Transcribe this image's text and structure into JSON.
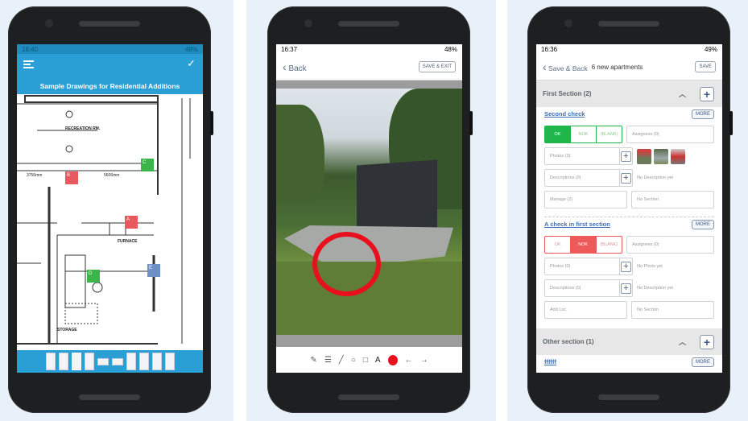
{
  "phone1": {
    "status": {
      "time": "16:40",
      "battery": "48%"
    },
    "header": {
      "title": "Sample Drawings for Residential Additions",
      "menu_icon": "hamburger-icon",
      "confirm_icon": "check-icon"
    },
    "plan_labels": [
      "RECREATION RM.",
      "FURNACE",
      "STORAGE",
      "3756mm",
      "5606mm"
    ],
    "markers": [
      {
        "label": "C",
        "color": "#3ab54a"
      },
      {
        "label": "B",
        "color": "#e8595d"
      },
      {
        "label": "A",
        "color": "#e8595d"
      },
      {
        "label": "D",
        "color": "#3ab54a"
      },
      {
        "label": "E",
        "color": "#6f8fc9"
      }
    ],
    "thumbnail_count": 10,
    "accent": "#2a9fd6"
  },
  "phone2": {
    "status": {
      "time": "16:37",
      "battery": "48%"
    },
    "header": {
      "back_label": "Back",
      "save_exit_label": "SAVE & EXIT"
    },
    "tools": [
      "brush-icon",
      "stroke-width-icon",
      "line-icon",
      "circle-icon",
      "square-icon",
      "text-icon",
      "color-icon",
      "undo-icon",
      "redo-icon"
    ],
    "text_tool": "A",
    "active_color": "#e8101c"
  },
  "phone3": {
    "status": {
      "time": "16:36",
      "battery": "49%"
    },
    "header": {
      "back_label": "Save & Back",
      "title": "6 new apartments",
      "save_label": "SAVE"
    },
    "sections": [
      {
        "title": "First Section (2)",
        "checks": [
          {
            "name": "Second check",
            "more": "MORE",
            "options": [
              "OK",
              "NOK",
              "(BLANK)"
            ],
            "selected": "OK",
            "assignees": "Assignees (0)",
            "photos": "Photos (3)",
            "photo_note": "",
            "descriptions": "Descriptions (0)",
            "desc_note": "No Description yet",
            "location": "Manage (2)",
            "section": "No Section"
          },
          {
            "name": "A check in first section",
            "more": "MORE",
            "options": [
              "OK",
              "NOK",
              "(BLANK)"
            ],
            "selected": "NOK",
            "assignees": "Assignees (0)",
            "photos": "Photos (0)",
            "photo_note": "No Photo yet",
            "descriptions": "Descriptions (0)",
            "desc_note": "No Description yet",
            "location": "Add Loc.",
            "section": "No Section"
          }
        ]
      },
      {
        "title": "Other section (1)",
        "checks": [
          {
            "name": "ffffff",
            "more": "MORE"
          }
        ]
      }
    ],
    "ok_color": "#1fb64c",
    "nok_color": "#ee5a5a"
  }
}
